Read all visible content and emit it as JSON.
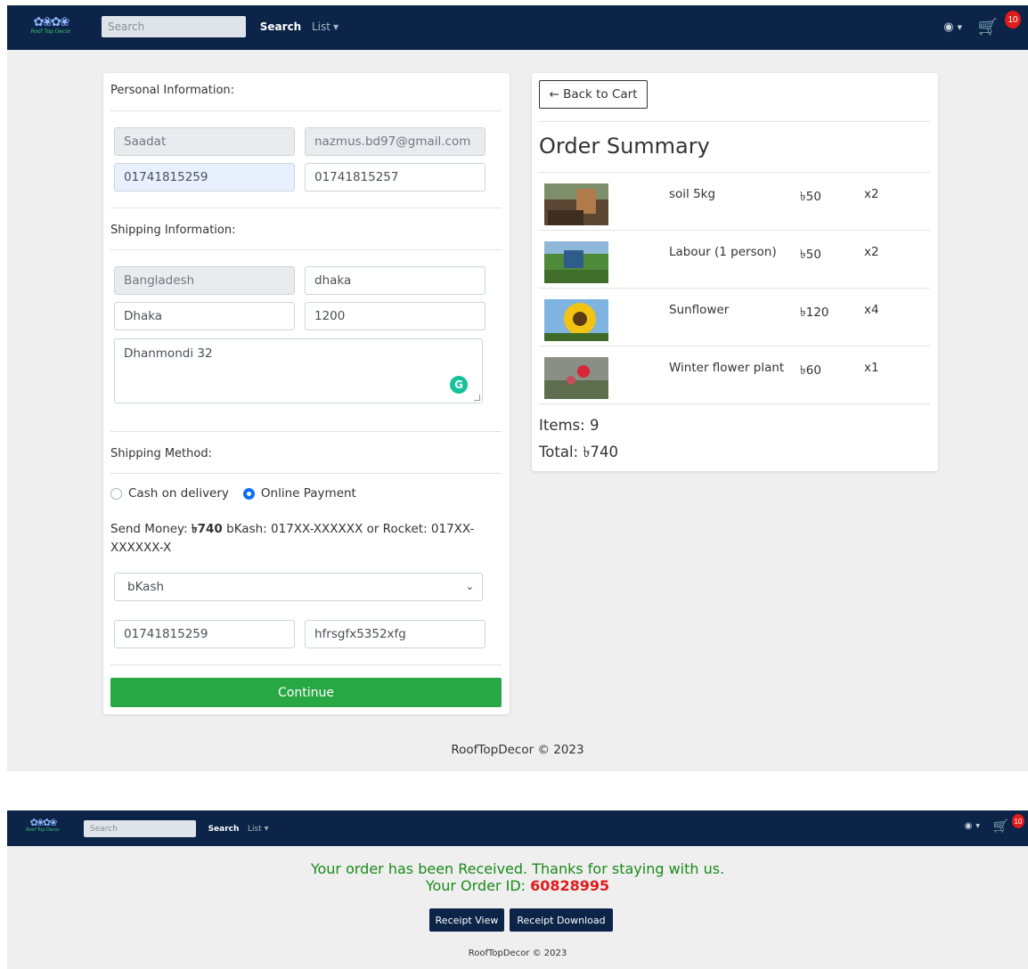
{
  "app": {
    "logo_text": "Roof Top Decor",
    "search_placeholder": "Search",
    "search_button": "Search",
    "list_menu": "List",
    "cart_count": "10"
  },
  "personal": {
    "heading": "Personal Information:",
    "first_name": "Saadat",
    "email": "nazmus.bd97@gmail.com",
    "phone": "01741815259",
    "alt_phone": "01741815257"
  },
  "shipping": {
    "heading": "Shipping Information:",
    "country": "Bangladesh",
    "city": "dhaka",
    "district": "Dhaka",
    "postcode": "1200",
    "address": "Dhanmondi 32"
  },
  "method": {
    "heading": "Shipping Method:",
    "options": [
      "Cash on delivery",
      "Online Payment"
    ],
    "selected": "Online Payment",
    "send_money_prefix": "Send Money: ",
    "send_money_amount": "৳740",
    "send_money_suffix": " bKash: 017XX-XXXXXX or Rocket: 017XX-XXXXXX-X",
    "provider_selected": "bKash",
    "payment_phone": "01741815259",
    "transaction_id": "hfrsgfx5352xfg",
    "continue_label": "Continue"
  },
  "summary": {
    "back_label": "← Back to Cart",
    "title": "Order Summary",
    "items": [
      {
        "name": "soil 5kg",
        "price": "৳50",
        "qty": "x2"
      },
      {
        "name": "Labour (1 person)",
        "price": "৳50",
        "qty": "x2"
      },
      {
        "name": "Sunflower",
        "price": "৳120",
        "qty": "x4"
      },
      {
        "name": "Winter flower plant",
        "price": "৳60",
        "qty": "x1"
      }
    ],
    "items_label": "Items: 9",
    "total_label": "Total: ৳740"
  },
  "footer": "RoofTopDecor © 2023",
  "confirmation": {
    "message": "Your order has been Received. Thanks for staying with us.",
    "order_id_label": "Your Order ID: ",
    "order_id": "60828995",
    "receipt_view": "Receipt View",
    "receipt_download": "Receipt Download"
  },
  "colors": {
    "navbar": "#0b2447",
    "continue_button": "#28a745",
    "badge": "#e01b1b",
    "success_text": "#1a8a1a"
  }
}
